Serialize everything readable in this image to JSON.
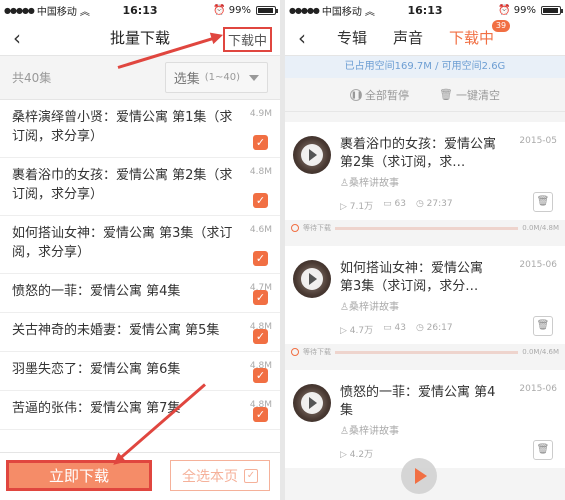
{
  "status_left": {
    "carrier": "中国移动",
    "time": "16:13",
    "battery": "99%"
  },
  "status_right": {
    "carrier": "中国移动",
    "time": "16:13",
    "battery": "99%"
  },
  "left": {
    "title": "批量下载",
    "nav_action": "下载中",
    "total": "共40集",
    "select_label": "选集",
    "select_range": "(1~40)",
    "episodes": [
      {
        "title": "桑梓演绎曾小贤：爱情公寓 第1集（求订阅，求分享）",
        "size": "4.9M"
      },
      {
        "title": "裹着浴巾的女孩：爱情公寓 第2集（求订阅，求分享）",
        "size": "4.8M"
      },
      {
        "title": "如何搭讪女神：爱情公寓 第3集（求订阅，求分享）",
        "size": "4.6M"
      },
      {
        "title": "愤怒的一菲：爱情公寓 第4集",
        "size": "4.7M"
      },
      {
        "title": "关古神奇的未婚妻：爱情公寓 第5集",
        "size": "4.8M"
      },
      {
        "title": "羽墨失恋了：爱情公寓 第6集",
        "size": "4.8M"
      },
      {
        "title": "苦逼的张伟：爱情公寓 第7集",
        "size": "4.8M"
      }
    ],
    "download_now": "立即下载",
    "select_page": "全选本页"
  },
  "right": {
    "tabs": [
      "专辑",
      "声音",
      "下载中"
    ],
    "badge": "39",
    "storage": "已占用空间169.7M / 可用空间2.6G",
    "pause_all": "全部暂停",
    "clear_all": "一键清空",
    "items": [
      {
        "title": "裹着浴巾的女孩：爱情公寓 第2集（求订阅，求…",
        "date": "2015-05",
        "author": "桑梓讲故事",
        "plays": "7.1万",
        "comments": "63",
        "duration": "27:37",
        "status": "等待下载",
        "progress": "0.0M/4.8M",
        "fraction": 0
      },
      {
        "title": "如何搭讪女神：爱情公寓 第3集（求订阅，求分…",
        "date": "2015-06",
        "author": "桑梓讲故事",
        "plays": "4.7万",
        "comments": "43",
        "duration": "26:17",
        "status": "等待下载",
        "progress": "0.0M/4.6M",
        "fraction": 0
      },
      {
        "title": "愤怒的一菲：爱情公寓 第4集",
        "date": "2015-06",
        "author": "桑梓讲故事",
        "plays": "4.2万",
        "comments": "",
        "duration": "",
        "status": "",
        "progress": "",
        "fraction": 0
      }
    ]
  },
  "icons": {
    "back": "chevron-left-icon",
    "check": "check-icon",
    "pause": "pause-icon",
    "trash": "trash-icon",
    "play": "play-icon",
    "clock": "clock-icon"
  },
  "colors": {
    "accent": "#f16f43",
    "annotation": "#e0463f",
    "storage_text": "#6d9ed3"
  }
}
